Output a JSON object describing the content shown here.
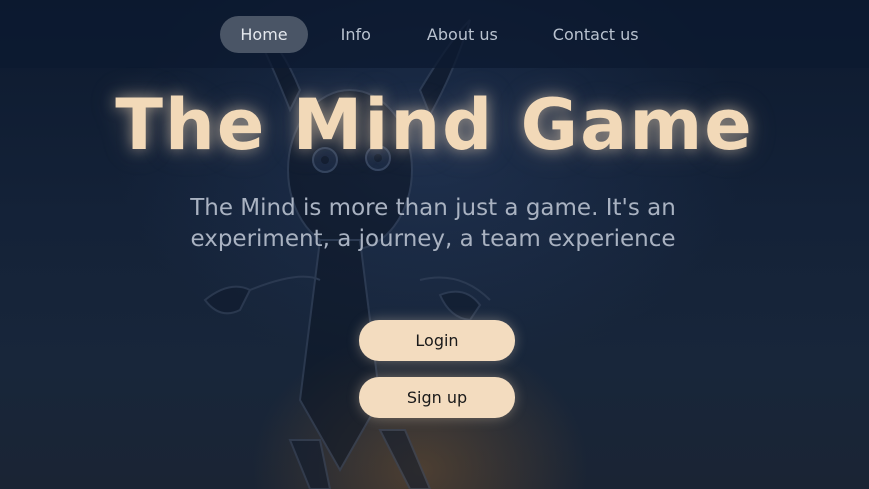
{
  "nav": {
    "items": [
      {
        "label": "Home",
        "active": true
      },
      {
        "label": "Info",
        "active": false
      },
      {
        "label": "About us",
        "active": false
      },
      {
        "label": "Contact us",
        "active": false
      }
    ]
  },
  "hero": {
    "title": "The Mind Game",
    "subtitle": "The Mind is more than just a game. It's an experiment, a journey, a team experience"
  },
  "actions": {
    "login_label": "Login",
    "signup_label": "Sign up"
  },
  "colors": {
    "accent": "#f3dcbf",
    "title": "#f2d9b8",
    "background": "#142238",
    "nav_active": "#4a5566"
  }
}
